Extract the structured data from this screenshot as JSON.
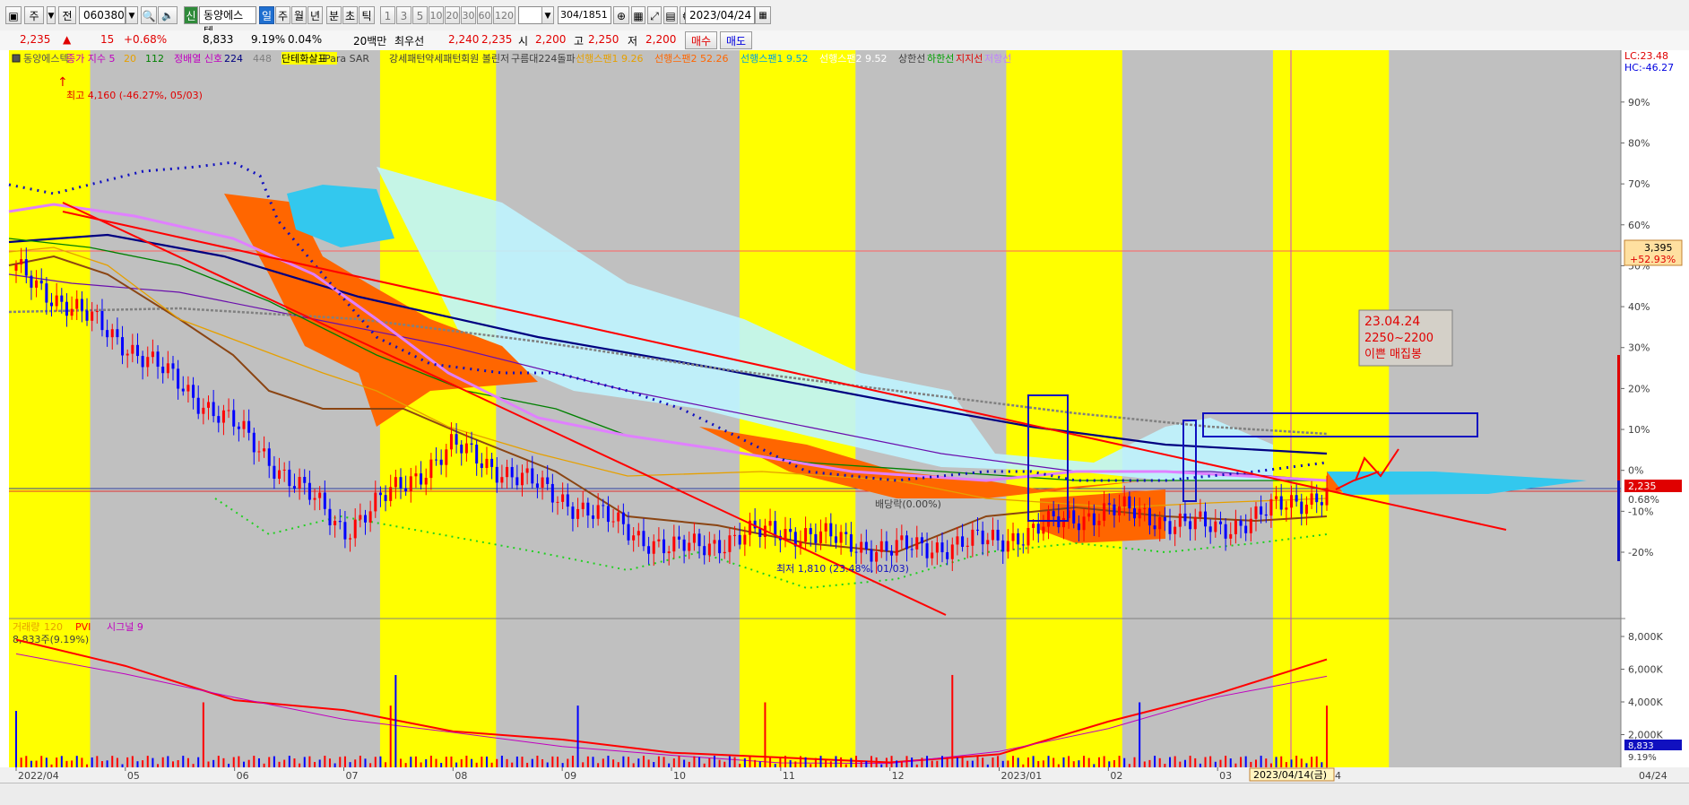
{
  "toolbar": {
    "market_label": "주",
    "scope_label": "전",
    "code": "060380",
    "badge": "신",
    "stock_name": "동양에스텍",
    "periods": [
      "일",
      "주",
      "월",
      "년",
      "분",
      "초",
      "틱"
    ],
    "intervals": [
      "1",
      "3",
      "5",
      "10",
      "20",
      "30",
      "60",
      "120"
    ],
    "count": "304",
    "total": "/1851",
    "date": "2023/04/24"
  },
  "quote": {
    "price": "2,235",
    "arrow": "▲",
    "change": "15",
    "change_pct": "+0.68%",
    "volume": "8,833",
    "turnover_pct": "9.19%",
    "ratio": "0.04%",
    "amount_label": "20백만",
    "best_label": "최우선",
    "best_ask": "2,240",
    "best_bid": "2,235",
    "open_label": "시",
    "open": "2,200",
    "high_label": "고",
    "high": "2,250",
    "low_label": "저",
    "low": "2,200",
    "buy_label": "매수",
    "sell_label": "매도"
  },
  "legend": [
    {
      "text": "동양에스텍",
      "color": "#555555"
    },
    {
      "text": "종가 지수 5",
      "color": "#c000c0"
    },
    {
      "text": "20",
      "color": "#e6a000"
    },
    {
      "text": "112",
      "color": "#008000"
    },
    {
      "text": "정배열 신호",
      "color": "#c000c0"
    },
    {
      "text": "224",
      "color": "#000080"
    },
    {
      "text": "448",
      "color": "#808080"
    },
    {
      "text": "단테화살표",
      "color": "#000000"
    },
    {
      "text": "Para SAR",
      "color": "#404040"
    },
    {
      "text": "강세패턴",
      "color": "#404040"
    },
    {
      "text": "약세패턴",
      "color": "#404040"
    },
    {
      "text": "회원 볼린저",
      "color": "#404040"
    },
    {
      "text": "구름대224돌파",
      "color": "#404040"
    },
    {
      "text": "선행스팬1 9.26",
      "color": "#e6a000"
    },
    {
      "text": "선행스팬2 52.26",
      "color": "#ff6600"
    },
    {
      "text": "선행스팬1 9.52",
      "color": "#00a0e0"
    },
    {
      "text": "선행스팬2 9.52",
      "color": "#ffffff"
    },
    {
      "text": "상한선",
      "color": "#404040"
    },
    {
      "text": "하한선",
      "color": "#00a000"
    },
    {
      "text": "지지선",
      "color": "#e00000"
    },
    {
      "text": "저항선",
      "color": "#c080ff"
    }
  ],
  "scale": {
    "top_left": "LC:23.48",
    "top_right": "HC:-46.27",
    "right_labels": [
      "90%",
      "80%",
      "70%",
      "60%",
      "50%",
      "40%",
      "30%",
      "20%",
      "10%",
      "0%",
      "-10%",
      "-20%"
    ],
    "price_box_1": "3,395",
    "price_box_1_pct": "+52.93%",
    "price_box_2": "2,235",
    "price_box_2_pct": "0.68%",
    "volume_labels": [
      "8,000K",
      "6,000K",
      "4,000K",
      "2,000K"
    ],
    "volume_box": "8,833",
    "volume_box_pct": "9.19%"
  },
  "annotations": {
    "high_marker": "최고 4,160 (-46.27%, 05/03)",
    "low_marker": "최저 1,810 (23.48%, 01/03)",
    "dividend_marker": "배당락(0.00%)",
    "note_line1": "23.04.24",
    "note_line2": "2250~2200",
    "note_line3": "이쁜 매집봉"
  },
  "volume_pane": {
    "legend": [
      {
        "text": "거래량",
        "color": "#e6a000"
      },
      {
        "text": "120",
        "color": "#e6a000"
      },
      {
        "text": "PVI",
        "color": "#ff0000"
      },
      {
        "text": "시그널 9",
        "color": "#c000c0"
      }
    ],
    "current": "8,833주(9.19%)"
  },
  "x_axis": {
    "labels": [
      "2022/04",
      "05",
      "06",
      "07",
      "08",
      "09",
      "10",
      "11",
      "12",
      "2023/01",
      "02",
      "03",
      "04"
    ],
    "cursor_label": "2023/04/14(금)",
    "right_label": "04/24"
  },
  "chart_data": {
    "type": "candlestick",
    "ticker": "060380",
    "name": "동양에스텍",
    "x_range": [
      "2022/04",
      "2023/04/24"
    ],
    "months": [
      "2022/04",
      "05",
      "06",
      "07",
      "08",
      "09",
      "10",
      "11",
      "12",
      "2023/01",
      "02",
      "03",
      "04"
    ],
    "y_range_pct": [
      -25,
      95
    ],
    "price_monthly_close": [
      {
        "month": "2022/04",
        "close": 3300
      },
      {
        "month": "05",
        "close": 2950
      },
      {
        "month": "06",
        "close": 2550
      },
      {
        "month": "07",
        "close": 2050
      },
      {
        "month": "08",
        "close": 2450
      },
      {
        "month": "09",
        "close": 2200
      },
      {
        "month": "10",
        "close": 1950
      },
      {
        "month": "11",
        "close": 2050
      },
      {
        "month": "12",
        "close": 1950
      },
      {
        "month": "2023/01",
        "close": 2000
      },
      {
        "month": "02",
        "close": 2150
      },
      {
        "month": "03",
        "close": 2050
      },
      {
        "month": "04",
        "close": 2235
      }
    ],
    "high": {
      "value": 4160,
      "date": "05/03",
      "pct": -46.27
    },
    "low": {
      "value": 1810,
      "date": "01/03",
      "pct": 23.48
    },
    "last": {
      "price": 2235,
      "change": 15,
      "change_pct": 0.68,
      "open": 2200,
      "high": 2250,
      "low": 2200
    },
    "volume_last": 8833,
    "volume_axis_max_k": 8000,
    "pvi_monthly_k": [
      {
        "month": "2022/04",
        "value": 7800
      },
      {
        "month": "05",
        "value": 6200
      },
      {
        "month": "06",
        "value": 4100
      },
      {
        "month": "07",
        "value": 3500
      },
      {
        "month": "08",
        "value": 2200
      },
      {
        "month": "09",
        "value": 1700
      },
      {
        "month": "10",
        "value": 900
      },
      {
        "month": "11",
        "value": 600
      },
      {
        "month": "12",
        "value": 300
      },
      {
        "month": "2023/01",
        "value": 800
      },
      {
        "month": "02",
        "value": 2800
      },
      {
        "month": "03",
        "value": 4500
      },
      {
        "month": "04",
        "value": 6600
      }
    ],
    "colors": {
      "up": "#ff0000",
      "down": "#0000ff",
      "highlight_band": "#ffff00",
      "background": "#c0c0c0",
      "cloud_a": "#ff6600",
      "cloud_b": "#bff4ff",
      "trendline": "#ff0000",
      "ma_224": "#000080",
      "ma_448": "#808080"
    }
  }
}
